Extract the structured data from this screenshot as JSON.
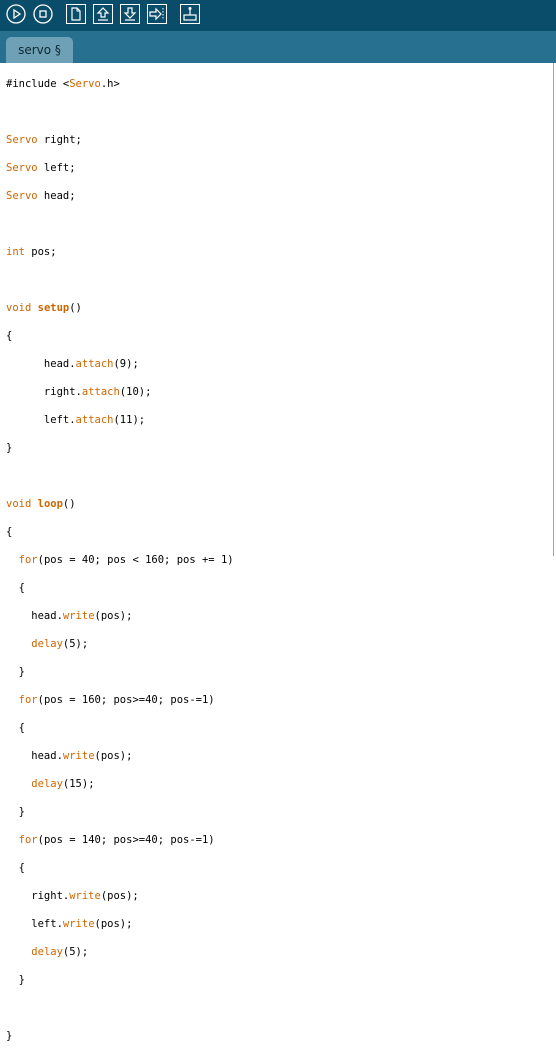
{
  "toolbar": {
    "buttons": [
      {
        "name": "verify-button",
        "icon": "play-icon"
      },
      {
        "name": "stop-button",
        "icon": "stop-icon"
      },
      {
        "name": "new-button",
        "icon": "new-file-icon"
      },
      {
        "name": "open-button",
        "icon": "open-icon"
      },
      {
        "name": "save-button",
        "icon": "save-icon"
      },
      {
        "name": "export-button",
        "icon": "export-icon"
      },
      {
        "name": "serial-monitor-button",
        "icon": "serial-monitor-icon"
      }
    ]
  },
  "tabs": [
    {
      "label": "servo §"
    }
  ],
  "colors": {
    "toolbar": "#0a4d6b",
    "tabbar": "#28708f",
    "tab": "#6fa1b6",
    "keyword": "#cc6600"
  },
  "code": {
    "l1a": "#include <",
    "l1b": "Servo",
    "l1c": ".h>",
    "l3a": "Servo",
    "l3b": " right;",
    "l4a": "Servo",
    "l4b": " left;",
    "l5a": "Servo",
    "l5b": " head;",
    "l7a": "int",
    "l7b": " pos;",
    "l9a": "void",
    "l9b": " ",
    "l9c": "setup",
    "l9d": "()",
    "l10": "{",
    "l11a": "      head.",
    "l11b": "attach",
    "l11c": "(9);",
    "l12a": "      right.",
    "l12b": "attach",
    "l12c": "(10);",
    "l13a": "      left.",
    "l13b": "attach",
    "l13c": "(11);",
    "l14": "}",
    "l16a": "void",
    "l16b": " ",
    "l16c": "loop",
    "l16d": "()",
    "l17": "{",
    "l18a": "  ",
    "l18b": "for",
    "l18c": "(pos = 40; pos < 160; pos += 1)",
    "l19": "  {",
    "l20a": "    head.",
    "l20b": "write",
    "l20c": "(pos);",
    "l21a": "    ",
    "l21b": "delay",
    "l21c": "(5);",
    "l22": "  }",
    "l23a": "  ",
    "l23b": "for",
    "l23c": "(pos = 160; pos>=40; pos-=1)",
    "l24": "  {",
    "l25a": "    head.",
    "l25b": "write",
    "l25c": "(pos);",
    "l26a": "    ",
    "l26b": "delay",
    "l26c": "(15);",
    "l27": "  }",
    "l28a": "  ",
    "l28b": "for",
    "l28c": "(pos = 140; pos>=40; pos-=1)",
    "l29": "  {",
    "l30a": "    right.",
    "l30b": "write",
    "l30c": "(pos);",
    "l31a": "    left.",
    "l31b": "write",
    "l31c": "(pos);",
    "l32a": "    ",
    "l32b": "delay",
    "l32c": "(5);",
    "l33": "  }",
    "l35": "}"
  }
}
